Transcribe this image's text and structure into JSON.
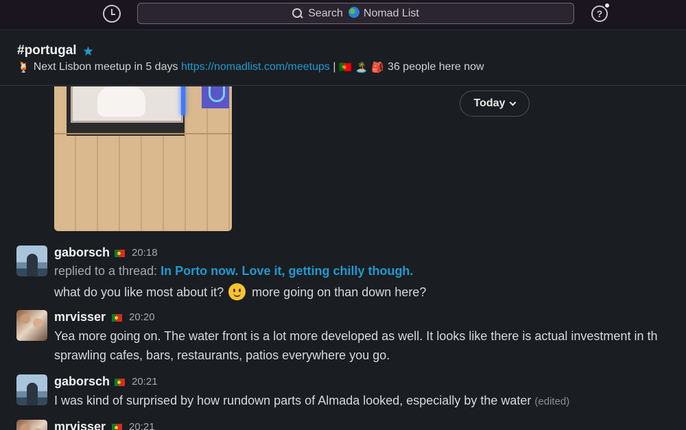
{
  "search": {
    "label": "Search",
    "workspace": "Nomad List"
  },
  "channel": {
    "name": "#portugal",
    "topic_text": "Next Lisbon meetup in 5 days",
    "topic_emoji": "🍹",
    "topic_link": "https://nomadlist.com/meetups",
    "topic_separator": "|",
    "topic_emojis_after": [
      "🇵🇹",
      "🏝️",
      "🎒"
    ],
    "people_count": "36 people here now"
  },
  "date_divider": {
    "label": "Today"
  },
  "messages": [
    {
      "user": "gaborsch",
      "time": "20:18",
      "reply_label": "replied to a thread:",
      "thread_title": "In Porto now. Love it, getting chilly though.",
      "text_before_emoji": "what do you like most about it?",
      "text_after_emoji": "more going on than down here?"
    },
    {
      "user": "mrvisser",
      "time": "20:20",
      "line1": "Yea more going on. The water front is a lot more developed as well. It looks like there is actual investment in th",
      "line2": "sprawling cafes, bars, restaurants, patios everywhere you go."
    },
    {
      "user": "gaborsch",
      "time": "20:21",
      "text": "I was kind of surprised by how rundown parts of Almada looked, especially by the water",
      "edited": "(edited)"
    },
    {
      "user": "mrvisser",
      "time": "20:21"
    }
  ],
  "colors": {
    "background": "#1a1d21",
    "link": "#1d9bd1",
    "topbar": "#1b1520"
  },
  "icons": [
    "history-icon",
    "search-icon",
    "globe-icon",
    "help-icon",
    "star-icon",
    "chevron-down-icon",
    "flag-portugal-icon",
    "slightly-smiling-face-icon"
  ]
}
